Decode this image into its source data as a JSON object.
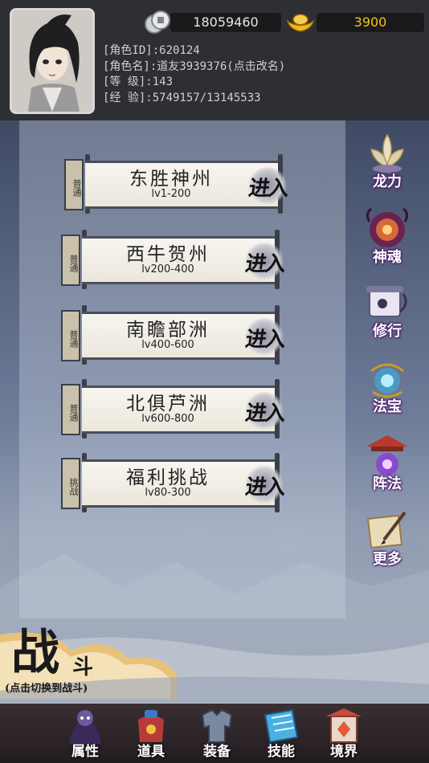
{
  "header": {
    "currency": [
      {
        "icon": "silver-coin-icon",
        "value": "18059460"
      },
      {
        "icon": "gold-ingot-icon",
        "value": "3900",
        "color": "#f2c21a"
      }
    ],
    "info": [
      {
        "label": "[角色ID]:",
        "value": "620124"
      },
      {
        "label": "[角色名]:",
        "value": "道友3939376(点击改名)"
      },
      {
        "label": "[等  级]:",
        "value": "143"
      },
      {
        "label": "[经  验]:",
        "value": "5749157/13145533"
      }
    ]
  },
  "maps": [
    {
      "tag": "普通",
      "name": "东胜神州",
      "range": "lv1-200",
      "enter": "进入"
    },
    {
      "tag": "普通",
      "name": "西牛贺州",
      "range": "lv200-400",
      "enter": "进入"
    },
    {
      "tag": "普通",
      "name": "南瞻部洲",
      "range": "lv400-600",
      "enter": "进入"
    },
    {
      "tag": "普通",
      "name": "北俱芦洲",
      "range": "lv600-800",
      "enter": "进入"
    },
    {
      "tag": "挑战",
      "name": "福利挑战",
      "range": "lv80-300",
      "enter": "进入"
    }
  ],
  "side_menu": [
    {
      "icon": "lotus-crown-icon",
      "label": "龙力"
    },
    {
      "icon": "demon-orb-icon",
      "label": "神魂"
    },
    {
      "icon": "cultivation-scroll-icon",
      "label": "修行"
    },
    {
      "icon": "magic-treasure-icon",
      "label": "法宝"
    },
    {
      "icon": "formation-pavilion-icon",
      "label": "阵法"
    },
    {
      "icon": "scroll-brush-icon",
      "label": "更多"
    }
  ],
  "battle": {
    "title": "战",
    "subtitle": "斗",
    "hint": "(点击切换到战斗)"
  },
  "bottom_tabs": [
    {
      "icon": "character-icon",
      "label": "属性"
    },
    {
      "icon": "item-bag-icon",
      "label": "道具"
    },
    {
      "icon": "armor-icon",
      "label": "装备"
    },
    {
      "icon": "skill-book-icon",
      "label": "技能"
    },
    {
      "icon": "realm-gate-icon",
      "label": "境界"
    }
  ],
  "colors": {
    "gold_text": "#f2c21a",
    "label_purple": "#4b1d6a",
    "panel_bg": "#2e2f33"
  }
}
